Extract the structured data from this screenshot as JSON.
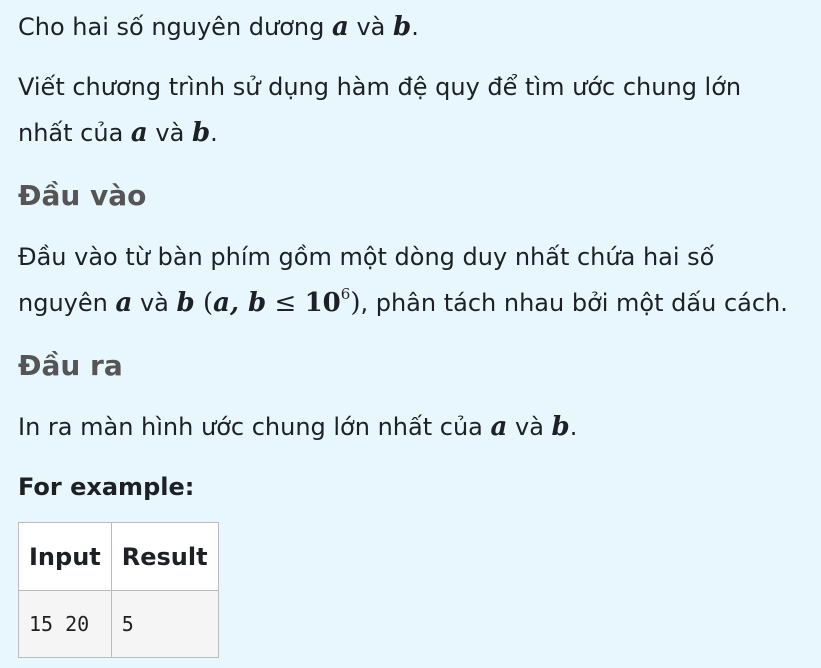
{
  "intro": {
    "line1_prefix": "Cho hai số nguyên dương ",
    "var_a": "a",
    "and": " và ",
    "var_b": "b",
    "line1_suffix": ".",
    "line2_prefix": "Viết chương trình sử dụng hàm đệ quy để tìm ước chung lớn",
    "line3_prefix": "nhất của ",
    "line3_suffix": "."
  },
  "input_section": {
    "heading": "Đầu vào",
    "line1": "Đầu vào từ bàn phím gồm một dòng duy nhất chứa hai số",
    "line2_prefix": "nguyên ",
    "constraint_open": "(",
    "constraint_ab": "a, b",
    "constraint_le": " ≤ ",
    "constraint_base": "10",
    "constraint_exp": "6",
    "constraint_close": ")",
    "line2_suffix": ", phân tách nhau bởi một dấu cách."
  },
  "output_section": {
    "heading": "Đầu ra",
    "line_prefix": "In ra màn hình ước chung lớn nhất của ",
    "line_suffix": "."
  },
  "example": {
    "label": "For example:",
    "columns": [
      "Input",
      "Result"
    ],
    "rows": [
      [
        "15 20",
        "5"
      ]
    ]
  }
}
